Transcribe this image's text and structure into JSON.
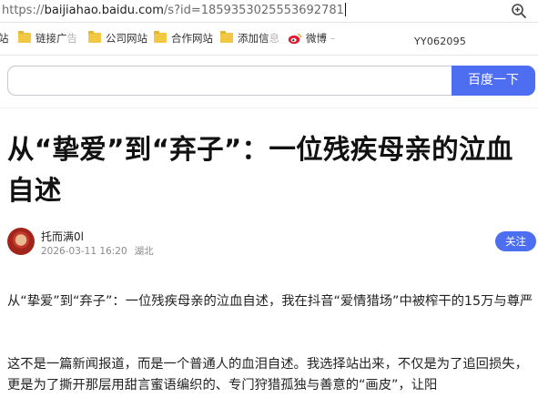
{
  "browser": {
    "url_scheme": "https://",
    "url_host": "baijiahao.baidu.com",
    "url_rest": "/s?id=1859353025553692781"
  },
  "bookmarks": {
    "items": [
      {
        "label": "站"
      },
      {
        "label": "链接广",
        "fade": "告"
      },
      {
        "label": "公司网站"
      },
      {
        "label": "合作网站"
      },
      {
        "label": "添加信",
        "fade": "息"
      },
      {
        "label": "微博",
        "fade": " –"
      }
    ],
    "code": "YY062095"
  },
  "search": {
    "button_label": "百度一下"
  },
  "article": {
    "title": "从“挚爱”到“弃子”：一位残疾母亲的泣血自述",
    "author": "托而满0l",
    "date": "2026-03-11 16:20",
    "location": "湖北",
    "follow_label": "关注",
    "paragraphs": [
      "从“挚爱”到“弃子”：一位残疾母亲的泣血自述，我在抖音“爱情猎场”中被榨干的15万与尊严",
      "这不是一篇新闻报道，而是一个普通人的血泪自述。我选择站出来，不仅是为了追回损失，更是为了撕开那层用甜言蜜语编织的、专门狩猎孤独与善意的“画皮”，让阳"
    ]
  },
  "colors": {
    "accent": "#4e6ef2",
    "folder": "#f2c744"
  }
}
